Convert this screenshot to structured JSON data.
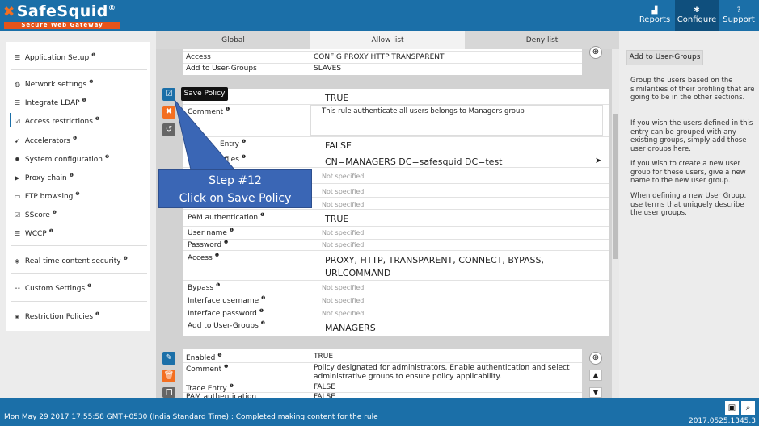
{
  "app": {
    "logo_name": "SafeSquid",
    "logo_mark": "®",
    "logo_tagline": "Secure Web Gateway"
  },
  "topnav": [
    {
      "label": "Reports",
      "icon": "bar-chart-icon"
    },
    {
      "label": "Configure",
      "icon": "gears-icon"
    },
    {
      "label": "Support",
      "icon": "question-icon"
    }
  ],
  "sidebar": {
    "items": [
      {
        "label": "Application Setup",
        "icon": "list-icon"
      },
      {
        "label": "Network settings",
        "icon": "globe-icon"
      },
      {
        "label": "Integrate LDAP",
        "icon": "list-icon"
      },
      {
        "label": "Access restrictions",
        "icon": "checkbox-icon"
      },
      {
        "label": "Accelerators",
        "icon": "rocket-icon"
      },
      {
        "label": "System configuration",
        "icon": "gear-icon"
      },
      {
        "label": "Proxy chain",
        "icon": "forward-icon"
      },
      {
        "label": "FTP browsing",
        "icon": "folder-icon"
      },
      {
        "label": "SScore",
        "icon": "checkbox-icon"
      },
      {
        "label": "WCCP",
        "icon": "list-icon"
      },
      {
        "label": "Real time content security",
        "icon": "shield-icon"
      },
      {
        "label": "Custom Settings",
        "icon": "sliders-icon"
      },
      {
        "label": "Restriction Policies",
        "icon": "shield-icon"
      }
    ],
    "info_mark": "❶"
  },
  "tabs": [
    "Global",
    "Allow list",
    "Deny list"
  ],
  "prev_entry": {
    "rows": [
      {
        "label": "Access",
        "value": "CONFIG  PROXY  HTTP  TRANSPARENT"
      },
      {
        "label": "Add to User-Groups",
        "value": "SLAVES"
      }
    ]
  },
  "edit_entry": {
    "enabled_value": "TRUE",
    "comment_label": "Comment",
    "comment_value": "This rule authenticate all users belongs to Managers group",
    "trace_label": "Entry",
    "trace_value": "FALSE",
    "profiles_label": "ofiles",
    "profiles_value": "CN=MANAGERS DC=safesquid DC=test",
    "not_specified": "Not specified",
    "rows": [
      {
        "label": "PAM authentication",
        "value": "TRUE"
      },
      {
        "label": "User name",
        "value": "Not specified"
      },
      {
        "label": "Password",
        "value": "Not specified"
      },
      {
        "label": "Access",
        "value": "PROXY,  HTTP,  TRANSPARENT,  CONNECT,  BYPASS,"
      },
      {
        "label": "",
        "value": "URLCOMMAND"
      },
      {
        "label": "Bypass",
        "value": "Not specified"
      },
      {
        "label": "Interface username",
        "value": "Not specified"
      },
      {
        "label": "Interface password",
        "value": "Not specified"
      },
      {
        "label": "Add to User-Groups",
        "value": "MANAGERS"
      }
    ]
  },
  "tooltip": "Save Policy",
  "callout": {
    "line1": "Step #12",
    "line2": "Click on Save Policy"
  },
  "next_entry": {
    "rows": [
      {
        "label": "Enabled",
        "value": "TRUE"
      },
      {
        "label": "Comment",
        "value": "Policy designated for administrators. Enable authentication and select"
      },
      {
        "label": "",
        "value": "administrative groups to ensure policy applicability."
      },
      {
        "label": "Trace Entry",
        "value": "FALSE"
      },
      {
        "label": "PAM authentication",
        "value": "FALSE"
      }
    ]
  },
  "help": {
    "button": "Add to User-Groups",
    "paragraphs": [
      "Group the users based on the similarities of their profiling that are going to be in the other sections.",
      "If you wish the users defined in this entry can be grouped with any existing groups, simply add those user groups here.",
      "If you wish to create a new user group for these users, give a new name to the new user group.",
      "When defining a new User Group, use terms that uniquely describe the user groups."
    ]
  },
  "footer": {
    "status": "Mon May 29 2017 17:55:58 GMT+0530 (India Standard Time) : Completed making content for the rule",
    "version": "2017.0525.1345.3"
  },
  "colors": {
    "brand_blue": "#1b6fa8",
    "brand_orange": "#f36f21",
    "callout": "#3a66b5"
  }
}
